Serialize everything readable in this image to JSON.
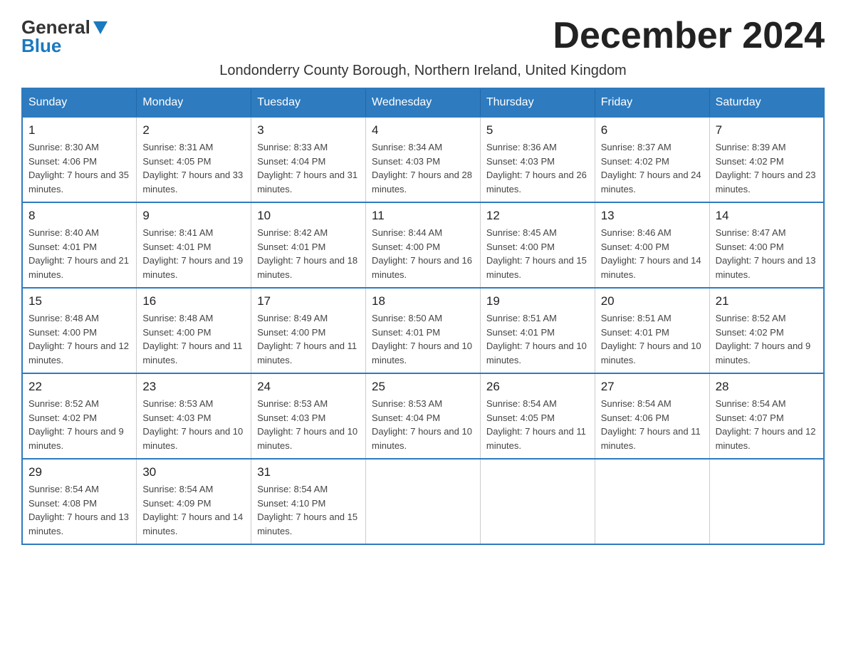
{
  "logo": {
    "general": "General",
    "blue": "Blue"
  },
  "title": "December 2024",
  "subtitle": "Londonderry County Borough, Northern Ireland, United Kingdom",
  "days_of_week": [
    "Sunday",
    "Monday",
    "Tuesday",
    "Wednesday",
    "Thursday",
    "Friday",
    "Saturday"
  ],
  "weeks": [
    [
      {
        "day": "1",
        "sunrise": "8:30 AM",
        "sunset": "4:06 PM",
        "daylight": "7 hours and 35 minutes."
      },
      {
        "day": "2",
        "sunrise": "8:31 AM",
        "sunset": "4:05 PM",
        "daylight": "7 hours and 33 minutes."
      },
      {
        "day": "3",
        "sunrise": "8:33 AM",
        "sunset": "4:04 PM",
        "daylight": "7 hours and 31 minutes."
      },
      {
        "day": "4",
        "sunrise": "8:34 AM",
        "sunset": "4:03 PM",
        "daylight": "7 hours and 28 minutes."
      },
      {
        "day": "5",
        "sunrise": "8:36 AM",
        "sunset": "4:03 PM",
        "daylight": "7 hours and 26 minutes."
      },
      {
        "day": "6",
        "sunrise": "8:37 AM",
        "sunset": "4:02 PM",
        "daylight": "7 hours and 24 minutes."
      },
      {
        "day": "7",
        "sunrise": "8:39 AM",
        "sunset": "4:02 PM",
        "daylight": "7 hours and 23 minutes."
      }
    ],
    [
      {
        "day": "8",
        "sunrise": "8:40 AM",
        "sunset": "4:01 PM",
        "daylight": "7 hours and 21 minutes."
      },
      {
        "day": "9",
        "sunrise": "8:41 AM",
        "sunset": "4:01 PM",
        "daylight": "7 hours and 19 minutes."
      },
      {
        "day": "10",
        "sunrise": "8:42 AM",
        "sunset": "4:01 PM",
        "daylight": "7 hours and 18 minutes."
      },
      {
        "day": "11",
        "sunrise": "8:44 AM",
        "sunset": "4:00 PM",
        "daylight": "7 hours and 16 minutes."
      },
      {
        "day": "12",
        "sunrise": "8:45 AM",
        "sunset": "4:00 PM",
        "daylight": "7 hours and 15 minutes."
      },
      {
        "day": "13",
        "sunrise": "8:46 AM",
        "sunset": "4:00 PM",
        "daylight": "7 hours and 14 minutes."
      },
      {
        "day": "14",
        "sunrise": "8:47 AM",
        "sunset": "4:00 PM",
        "daylight": "7 hours and 13 minutes."
      }
    ],
    [
      {
        "day": "15",
        "sunrise": "8:48 AM",
        "sunset": "4:00 PM",
        "daylight": "7 hours and 12 minutes."
      },
      {
        "day": "16",
        "sunrise": "8:48 AM",
        "sunset": "4:00 PM",
        "daylight": "7 hours and 11 minutes."
      },
      {
        "day": "17",
        "sunrise": "8:49 AM",
        "sunset": "4:00 PM",
        "daylight": "7 hours and 11 minutes."
      },
      {
        "day": "18",
        "sunrise": "8:50 AM",
        "sunset": "4:01 PM",
        "daylight": "7 hours and 10 minutes."
      },
      {
        "day": "19",
        "sunrise": "8:51 AM",
        "sunset": "4:01 PM",
        "daylight": "7 hours and 10 minutes."
      },
      {
        "day": "20",
        "sunrise": "8:51 AM",
        "sunset": "4:01 PM",
        "daylight": "7 hours and 10 minutes."
      },
      {
        "day": "21",
        "sunrise": "8:52 AM",
        "sunset": "4:02 PM",
        "daylight": "7 hours and 9 minutes."
      }
    ],
    [
      {
        "day": "22",
        "sunrise": "8:52 AM",
        "sunset": "4:02 PM",
        "daylight": "7 hours and 9 minutes."
      },
      {
        "day": "23",
        "sunrise": "8:53 AM",
        "sunset": "4:03 PM",
        "daylight": "7 hours and 10 minutes."
      },
      {
        "day": "24",
        "sunrise": "8:53 AM",
        "sunset": "4:03 PM",
        "daylight": "7 hours and 10 minutes."
      },
      {
        "day": "25",
        "sunrise": "8:53 AM",
        "sunset": "4:04 PM",
        "daylight": "7 hours and 10 minutes."
      },
      {
        "day": "26",
        "sunrise": "8:54 AM",
        "sunset": "4:05 PM",
        "daylight": "7 hours and 11 minutes."
      },
      {
        "day": "27",
        "sunrise": "8:54 AM",
        "sunset": "4:06 PM",
        "daylight": "7 hours and 11 minutes."
      },
      {
        "day": "28",
        "sunrise": "8:54 AM",
        "sunset": "4:07 PM",
        "daylight": "7 hours and 12 minutes."
      }
    ],
    [
      {
        "day": "29",
        "sunrise": "8:54 AM",
        "sunset": "4:08 PM",
        "daylight": "7 hours and 13 minutes."
      },
      {
        "day": "30",
        "sunrise": "8:54 AM",
        "sunset": "4:09 PM",
        "daylight": "7 hours and 14 minutes."
      },
      {
        "day": "31",
        "sunrise": "8:54 AM",
        "sunset": "4:10 PM",
        "daylight": "7 hours and 15 minutes."
      },
      null,
      null,
      null,
      null
    ]
  ]
}
